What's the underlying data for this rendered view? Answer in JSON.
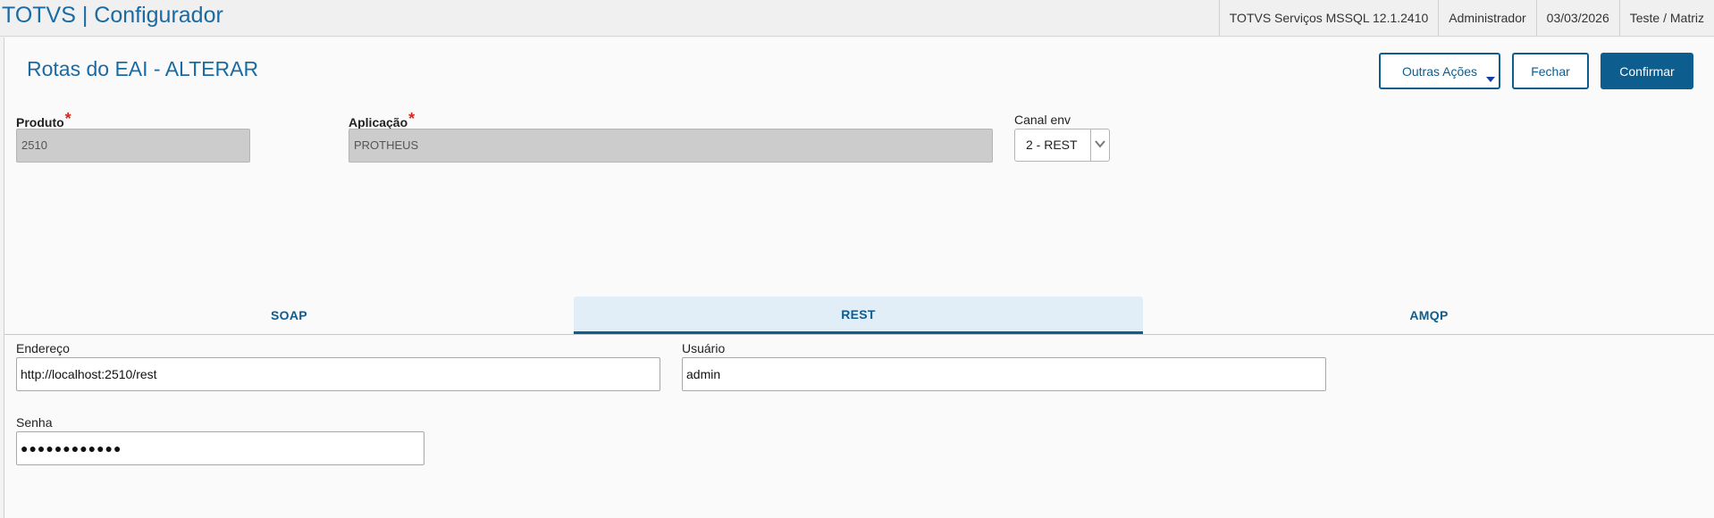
{
  "header": {
    "app_title": "TOTVS | Configurador",
    "environment": "TOTVS Serviços MSSQL 12.1.2410",
    "user": "Administrador",
    "date": "03/03/2026",
    "company": "Teste / Matriz"
  },
  "page": {
    "title": "Rotas do EAI - ALTERAR"
  },
  "actions": {
    "more_label": "Outras Ações",
    "close_label": "Fechar",
    "confirm_label": "Confirmar"
  },
  "form": {
    "produto": {
      "label": "Produto",
      "required_mark": "*",
      "value": "2510"
    },
    "aplicacao": {
      "label": "Aplicação",
      "required_mark": "*",
      "value": "PROTHEUS"
    },
    "canal_env": {
      "label": "Canal env",
      "value": "2 - REST"
    }
  },
  "tabs": [
    {
      "label": "SOAP"
    },
    {
      "label": "REST"
    },
    {
      "label": "AMQP"
    }
  ],
  "rest": {
    "endereco": {
      "label": "Endereço",
      "value": "http://localhost:2510/rest"
    },
    "usuario": {
      "label": "Usuário",
      "value": "admin"
    },
    "senha": {
      "label": "Senha",
      "value": "●●●●●●●●●●●●"
    }
  },
  "colors": {
    "brand": "#1a6aa3",
    "primary": "#0e5d8f",
    "required": "#d9261c",
    "active_tab_bg": "#e1edf7"
  }
}
